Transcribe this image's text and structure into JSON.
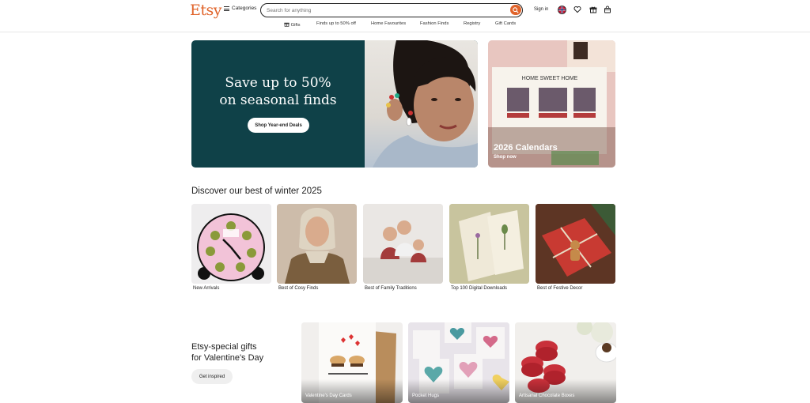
{
  "header": {
    "logo": "Etsy",
    "categories_label": "Categories",
    "search_placeholder": "Search for anything",
    "signin_label": "Sign in",
    "subnav": [
      {
        "label": "Gifts"
      },
      {
        "label": "Finds up to 50% off"
      },
      {
        "label": "Home Favourites"
      },
      {
        "label": "Fashion Finds"
      },
      {
        "label": "Registry"
      },
      {
        "label": "Gift Cards"
      }
    ]
  },
  "hero": {
    "title_line1": "Save up to 50%",
    "title_line2": "on seasonal finds",
    "button_label": "Shop Year-end Deals"
  },
  "calendar_card": {
    "title": "2026 Calendars",
    "cta": "Shop now",
    "poster_title": "HOME SWEET HOME"
  },
  "winter": {
    "title": "Discover our best of winter 2025",
    "tiles": [
      {
        "label": "New Arrivals",
        "icon": "clock-cocktail-icon"
      },
      {
        "label": "Best of Cosy Finds"
      },
      {
        "label": "Best of Family Traditions"
      },
      {
        "label": "Top 100 Digital Downloads"
      },
      {
        "label": "Best of Festive Decor"
      }
    ]
  },
  "valentine": {
    "title_line1": "Etsy-special gifts",
    "title_line2": "for Valentine's Day",
    "button_label": "Get inspired",
    "cards": [
      {
        "label": "Valentine's Day Cards"
      },
      {
        "label": "Pocket Hugs"
      },
      {
        "label": "Artisanal Chocolate Boxes"
      }
    ]
  },
  "colors": {
    "brand": "#e0632a",
    "hero_bg": "#0f4148"
  }
}
